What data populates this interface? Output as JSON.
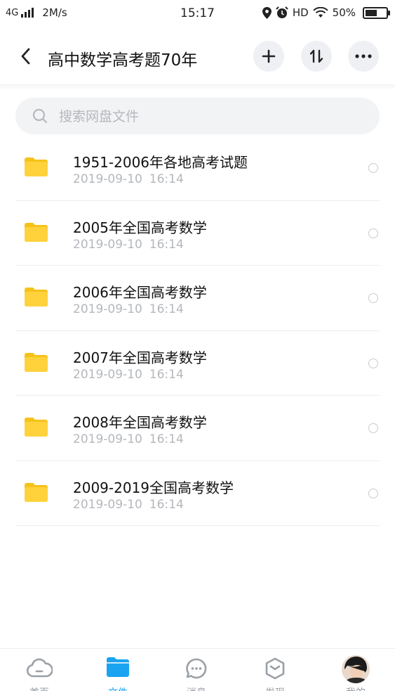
{
  "status_bar": {
    "network": "4G",
    "speed": "2M/s",
    "time": "15:17",
    "hd": "HD",
    "battery": "50%"
  },
  "header": {
    "title": "高中数学高考题70年",
    "icons": [
      "back-icon",
      "plus-icon",
      "sort-icon",
      "more-icon"
    ]
  },
  "search": {
    "placeholder": "搜索网盘文件",
    "icon": "search-icon"
  },
  "files": [
    {
      "name": "1951-2006年各地高考试题",
      "date": "2019-09-10",
      "time": "16:14"
    },
    {
      "name": "2005年全国高考数学",
      "date": "2019-09-10",
      "time": "16:14"
    },
    {
      "name": "2006年全国高考数学",
      "date": "2019-09-10",
      "time": "16:14"
    },
    {
      "name": "2007年全国高考数学",
      "date": "2019-09-10",
      "time": "16:14"
    },
    {
      "name": "2008年全国高考数学",
      "date": "2019-09-10",
      "time": "16:14"
    },
    {
      "name": "2009-2019全国高考数学",
      "date": "2019-09-10",
      "time": "16:14"
    }
  ],
  "bottom_nav": {
    "items": [
      {
        "label": "首页",
        "icon": "cloud-icon",
        "active": false
      },
      {
        "label": "文件",
        "icon": "folder-icon",
        "active": true
      },
      {
        "label": "消息",
        "icon": "chat-icon",
        "active": false
      },
      {
        "label": "发现",
        "icon": "discover-icon",
        "active": false
      },
      {
        "label": "我的",
        "icon": "avatar",
        "active": false
      }
    ]
  },
  "colors": {
    "accent": "#1aa3f0",
    "folder": "#ffd23c",
    "folder_tab": "#f5c21a",
    "muted_text": "#b4b7bc"
  }
}
